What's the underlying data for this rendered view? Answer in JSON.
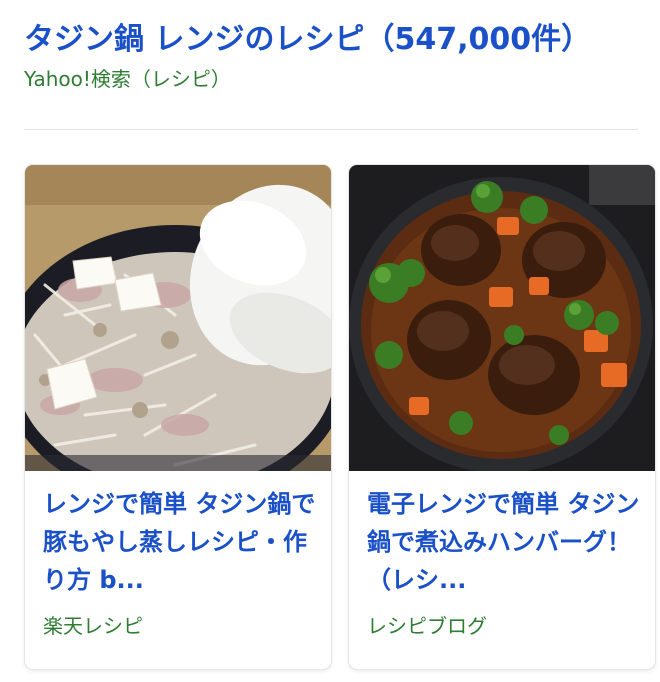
{
  "header": {
    "title": "タジン鍋 レンジのレシピ（547,000件）",
    "source": "Yahoo!検索（レシピ）"
  },
  "cards": [
    {
      "title": "レンジで簡単 タジン鍋で豚もやし蒸しレシピ・作り方 b...",
      "source": "楽天レシピ",
      "image": "tajine-pork-bean-sprouts-photo"
    },
    {
      "title": "電子レンジで簡単 タジン鍋で煮込みハンバーグ！（レシ...",
      "source": "レシピブログ",
      "image": "stewed-hamburger-steak-pot-photo"
    }
  ],
  "colors": {
    "link": "#1a50c8",
    "source": "#2e7d32",
    "divider": "#e2e2e2"
  }
}
